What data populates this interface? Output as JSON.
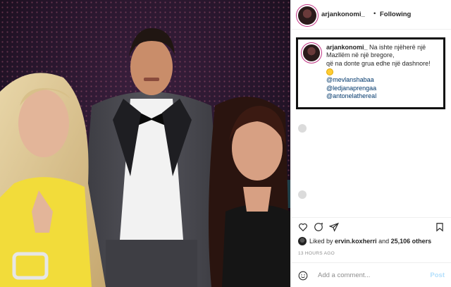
{
  "post": {
    "author": "arjankonomi_",
    "separator": "•",
    "follow_state": "Following",
    "caption": {
      "username": "arjankonomi_",
      "line1": "Na ishte njëherë një",
      "line2": "Mazllëm në një bregore,",
      "line3": "që na donte grua edhe një dashnore!",
      "mentions": [
        "@mevlanshabaa",
        "@ledjanaprengaa",
        "@antonelathereal"
      ]
    },
    "likes": {
      "prefix": "Liked by",
      "user": "ervin.koxherri",
      "middle": "and",
      "count": "25,106 others"
    },
    "timestamp": "13 HOURS AGO",
    "comment_placeholder": "Add a comment...",
    "post_label": "Post"
  },
  "colors": {
    "link": "#00376b",
    "muted": "#8e8e8e",
    "post_disabled": "#b2dffc",
    "story_ring": "#c13584"
  },
  "icons": [
    "heart-icon",
    "comment-icon",
    "share-icon",
    "bookmark-icon",
    "smile-icon"
  ]
}
